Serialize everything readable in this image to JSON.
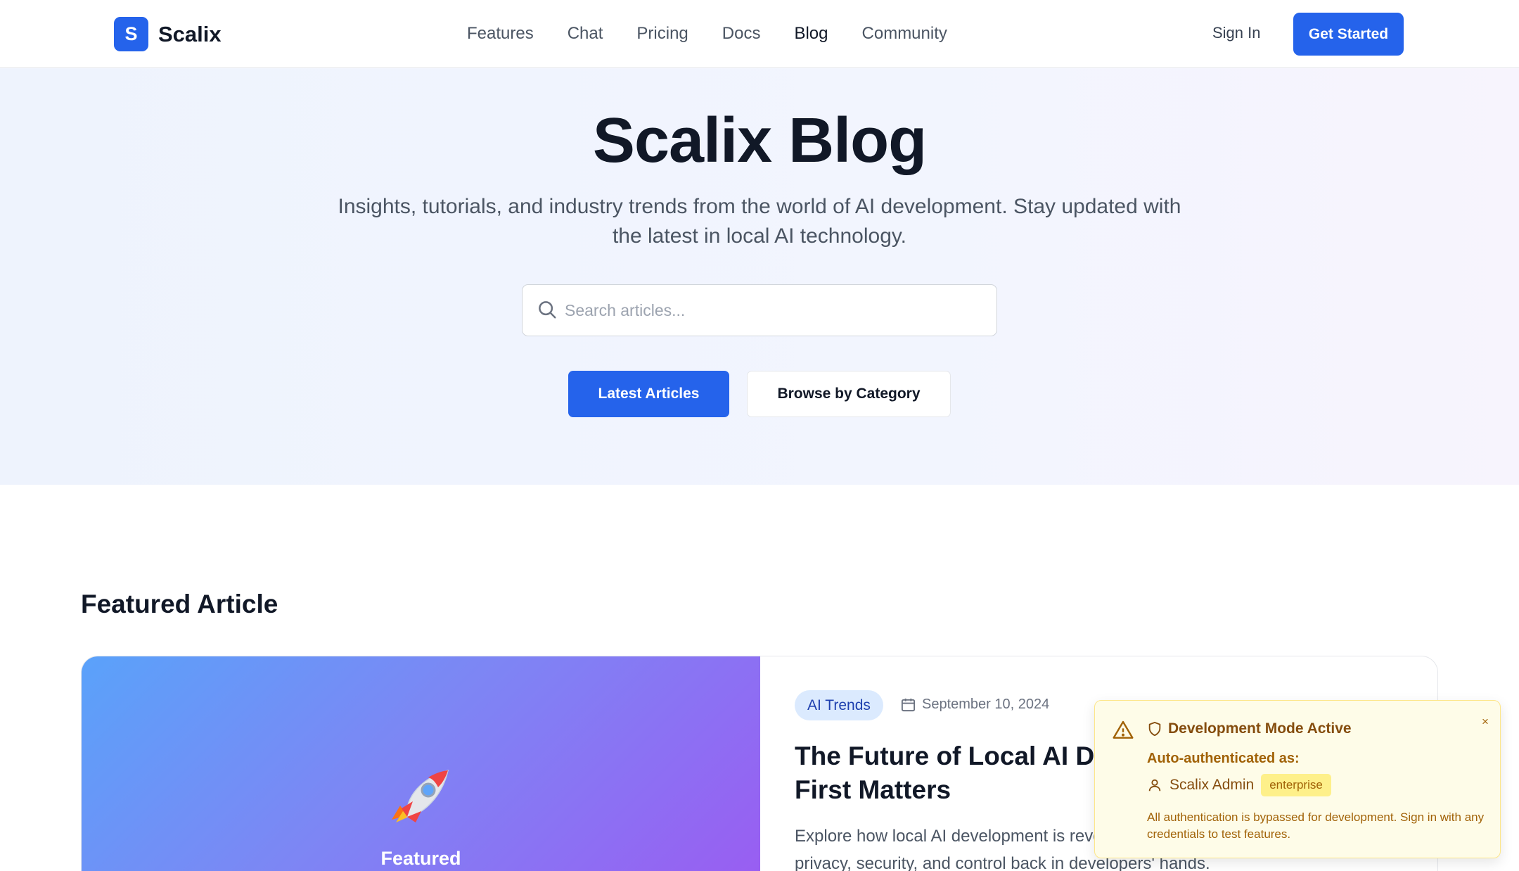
{
  "nav": {
    "logo_letter": "S",
    "brand": "Scalix",
    "links": [
      "Features",
      "Chat",
      "Pricing",
      "Docs",
      "Blog",
      "Community"
    ],
    "active": "Blog",
    "sign_in": "Sign In",
    "get_started": "Get Started"
  },
  "hero": {
    "title": "Scalix Blog",
    "subtitle": "Insights, tutorials, and industry trends from the world of AI development. Stay updated with the latest in local AI technology.",
    "search_placeholder": "Search articles...",
    "search_value": "",
    "primary_button": "Latest Articles",
    "secondary_button": "Browse by Category"
  },
  "featured": {
    "section_title": "Featured Article",
    "image_label": "Featured",
    "image_emoji_icon": "rocket-icon",
    "category": "AI Trends",
    "date": "September 10, 2024",
    "title_visible": "The Future of Local AI De",
    "title_line2": "First Matters",
    "excerpt_line1": "Explore how local AI development is revo",
    "excerpt_line2": "privacy, security, and control back in developers' hands."
  },
  "dev_notice": {
    "title": "Development Mode Active",
    "close": "×",
    "auth_label": "Auto-authenticated as:",
    "user": "Scalix Admin",
    "plan": "enterprise",
    "note": "All authentication is bypassed for development. Sign in with any credentials to test features."
  },
  "colors": {
    "brand_blue": "#2563eb",
    "notice_bg": "#fefce8",
    "notice_text": "#854d0e"
  }
}
